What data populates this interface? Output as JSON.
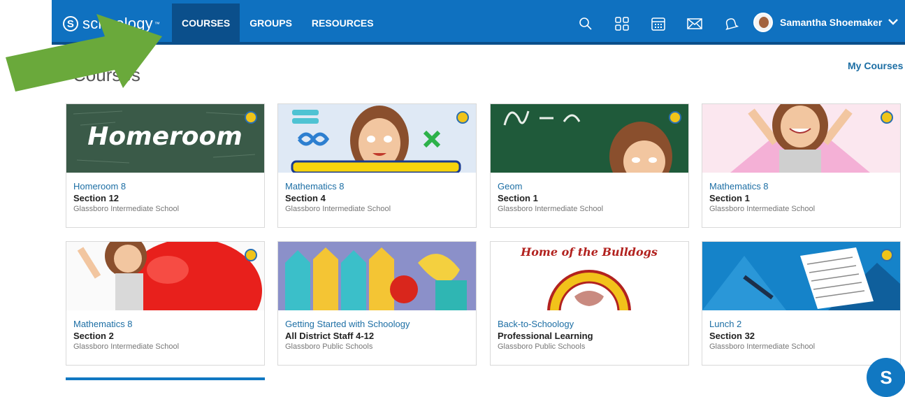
{
  "header": {
    "logo_text": "schoology",
    "tabs": [
      "COURSES",
      "GROUPS",
      "RESOURCES"
    ],
    "icons": [
      "search-icon",
      "grid-icon",
      "calendar-icon",
      "mail-icon",
      "bell-icon"
    ],
    "user_name": "Samantha Shoemaker"
  },
  "page": {
    "title": "Courses",
    "my_courses_link": "My Courses"
  },
  "courses": [
    {
      "title": "Homeroom 8",
      "section": "Section 12",
      "school": "Glassboro Intermediate School",
      "image_label": "Homeroom"
    },
    {
      "title": "Mathematics 8",
      "section": "Section 4",
      "school": "Glassboro Intermediate School"
    },
    {
      "title": "Geom",
      "section": "Section 1",
      "school": "Glassboro Intermediate School"
    },
    {
      "title": "Mathematics 8",
      "section": "Section 1",
      "school": "Glassboro Intermediate School"
    },
    {
      "title": "Mathematics 8",
      "section": "Section 2",
      "school": "Glassboro Intermediate School"
    },
    {
      "title": "Getting Started with Schoology",
      "section": "All District Staff 4-12",
      "school": "Glassboro Public Schools"
    },
    {
      "title": "Back-to-Schoology",
      "section": "Professional Learning",
      "school": "Glassboro Public Schools",
      "image_label": "Home of the Bulldogs"
    },
    {
      "title": "Lunch 2",
      "section": "Section 32",
      "school": "Glassboro Intermediate School"
    }
  ],
  "support_button": "S",
  "colors": {
    "header_bg": "#0f71c0",
    "active_tab": "#0b4f8b",
    "link": "#1c6ea4",
    "arrow": "#6aa93b"
  }
}
